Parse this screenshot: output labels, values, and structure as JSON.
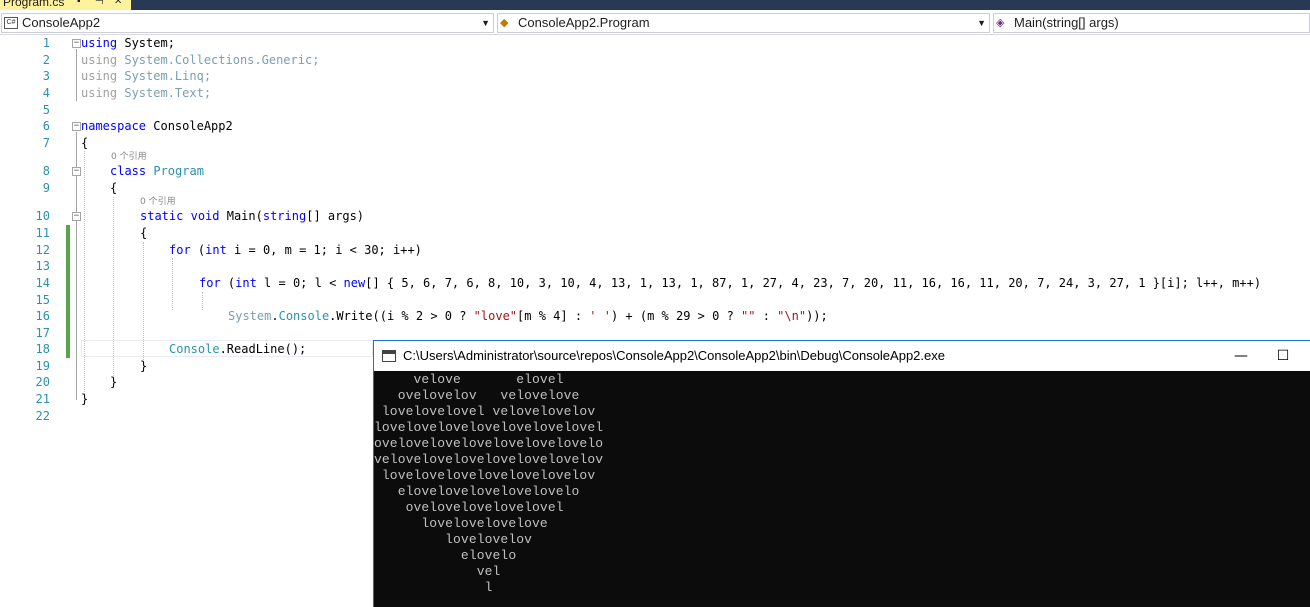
{
  "document_tab": {
    "filename": "Program.cs",
    "pin_icon": "pin-icon",
    "close_icon": "close-icon"
  },
  "navbar": {
    "project": "ConsoleApp2",
    "type": "ConsoleApp2.Program",
    "member": "Main(string[] args)"
  },
  "editor": {
    "line_numbers": [
      "1",
      "2",
      "3",
      "4",
      "5",
      "6",
      "7",
      "8",
      "9",
      "10",
      "11",
      "12",
      "13",
      "14",
      "15",
      "16",
      "17",
      "18",
      "19",
      "20",
      "21",
      "22"
    ],
    "codelens_refs": "0 个引用",
    "lines": {
      "l1": {
        "kw": "using",
        "rest": " System;"
      },
      "l2": {
        "kw": "using",
        "rest": " System.Collections.Generic;"
      },
      "l3": {
        "kw": "using",
        "rest": " System.Linq;"
      },
      "l4": {
        "kw": "using",
        "rest": " System.Text;"
      },
      "l6": {
        "kw": "namespace",
        "rest": " ConsoleApp2"
      },
      "l7": "{",
      "l8": {
        "kw": "class",
        "ty": "Program"
      },
      "l9": "{",
      "l10": {
        "kw1": "static",
        "kw2": "void",
        "name": "Main(",
        "kw3": "string",
        "rest": "[] args)"
      },
      "l11": "{",
      "l12": {
        "kw1": "for",
        "p1": " (",
        "kw2": "int",
        "rest": " i = 0, m = 1; i < 30; i++)"
      },
      "l14": {
        "kw1": "for",
        "p1": " (",
        "kw2": "int",
        "p2": " l = 0; l < ",
        "kw3": "new",
        "rest": "[] { 5, 6, 7, 6, 8, 10, 3, 10, 4, 13, 1, 13, 1, 87, 1, 27, 4, 23, 7, 20, 11, 16, 16, 11, 20, 7, 24, 3, 27, 1 }[i]; l++, m++)"
      },
      "l16": {
        "ty1": "System",
        "p1": ".",
        "ty2": "Console",
        "p2": ".Write((i % 2 > 0 ? ",
        "s1": "\"love\"",
        "p3": "[m % 4] : ",
        "s2": "' '",
        "p4": ") + (m % 29 > 0 ? ",
        "s3": "\"\"",
        "p5": " : ",
        "s4": "\"\\n\"",
        "p6": "));"
      },
      "l18": {
        "ty": "Console",
        "rest": ".ReadLine();"
      },
      "l19": "}",
      "l20": "}",
      "l21": "}"
    }
  },
  "console": {
    "title": "C:\\Users\\Administrator\\source\\repos\\ConsoleApp2\\ConsoleApp2\\bin\\Debug\\ConsoleApp2.exe",
    "minimize": "—",
    "maximize": "☐",
    "output": [
      "     velove       elovel",
      "   ovelovelov   velovelove",
      " lovelovelovel velovelovelov",
      "lovelovelovelovelovelovelovel",
      "ovelovelovelovelovelovelovelo",
      "velovelovelovelovelovelovelov",
      " lovelovelovelovelovelovelov",
      "   elovelovelovelovelovelo",
      "    ovelovelovelovelovel",
      "      lovelovelovelove",
      "         lovelovelov",
      "           elovelo",
      "             vel",
      "              l"
    ]
  }
}
